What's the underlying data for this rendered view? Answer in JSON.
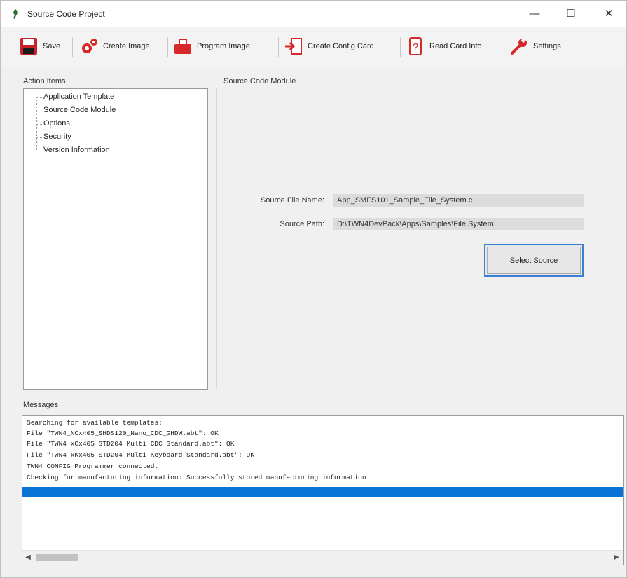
{
  "window": {
    "title": "Source Code Project",
    "controls": {
      "minimize": "—",
      "maximize": "☐",
      "close": "✕"
    }
  },
  "toolbar": {
    "save": "Save",
    "create_image": "Create Image",
    "program_image": "Program Image",
    "create_config_card": "Create Config Card",
    "read_card_info": "Read Card Info",
    "settings": "Settings"
  },
  "action_items": {
    "label": "Action Items",
    "items": [
      "Application Template",
      "Source Code Module",
      "Options",
      "Security",
      "Version Information"
    ]
  },
  "module": {
    "label": "Source Code Module",
    "source_file_label": "Source File Name:",
    "source_file_value": "App_SMFS101_Sample_File_System.c",
    "source_path_label": "Source Path:",
    "source_path_value": "D:\\TWN4DevPack\\Apps\\Samples\\File System",
    "select_button": "Select Source"
  },
  "messages": {
    "label": "Messages",
    "lines": [
      "Searching for available templates:",
      "File \"TWN4_NCx405_SHDS120_Nano_CDC_GHDW.abt\": OK",
      "File \"TWN4_xCx405_STD204_Multi_CDC_Standard.abt\": OK",
      "File \"TWN4_xKx405_STD204_Multi_Keyboard_Standard.abt\": OK",
      "TWN4 CONFIG Programmer connected.",
      "Checking for manufacturing information: Successfully stored manufacturing information."
    ]
  },
  "colors": {
    "accent": "#0a74d6",
    "icon_red": "#d62828",
    "button_focus": "#3a7fd4"
  },
  "icons": {
    "app": "app-icon",
    "save": "floppy-disk-icon",
    "create_image": "gears-icon",
    "program_image": "chip-programmer-icon",
    "create_config_card": "config-card-icon",
    "read_card_info": "question-card-icon",
    "settings": "wrench-icon"
  }
}
